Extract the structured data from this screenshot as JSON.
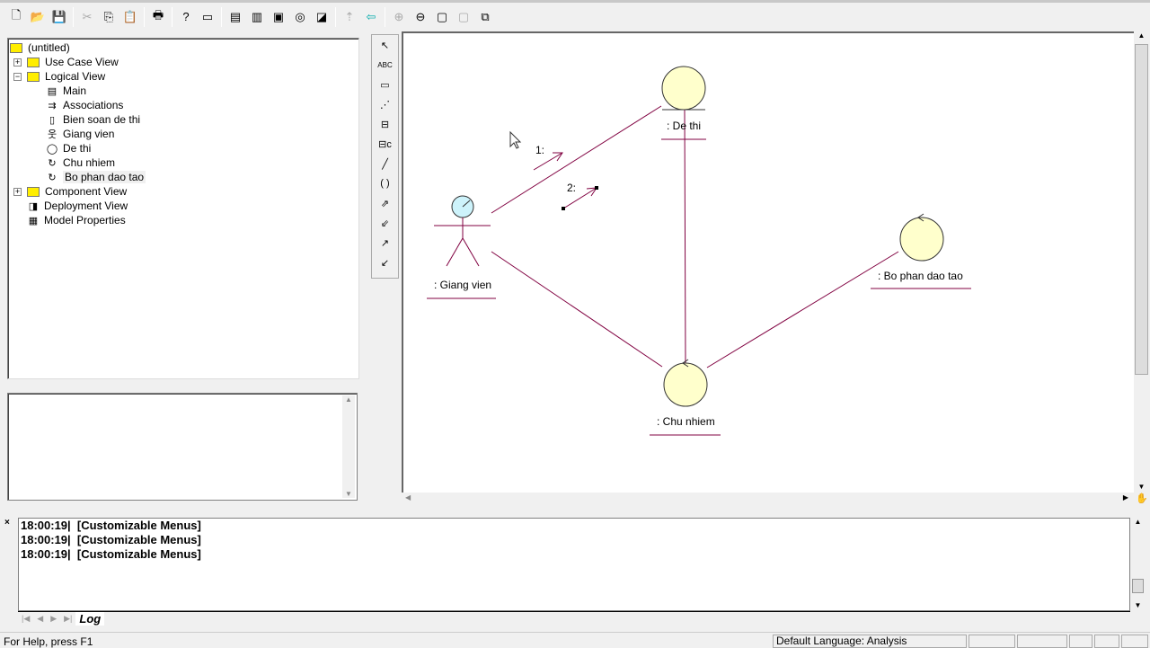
{
  "toolbar": {
    "buttons": [
      "new-icon",
      "open-icon",
      "save-icon",
      "cut-icon",
      "copy-icon",
      "paste-icon",
      "print-icon",
      "context-help-icon",
      "view-doc-icon",
      "class-diagram-icon",
      "interaction-diagram-icon",
      "component-diagram-icon",
      "state-diagram-icon",
      "deployment-diagram-icon",
      "parent-icon",
      "previous-diagram-icon",
      "zoom-in-icon",
      "zoom-out-icon",
      "fit-window-icon",
      "undo-fit-icon",
      "browse-icon"
    ]
  },
  "tree": {
    "root": "(untitled)",
    "items": [
      {
        "label": "Use Case View",
        "kind": "folder",
        "expander": "+"
      },
      {
        "label": "Logical View",
        "kind": "folder",
        "expander": "−"
      },
      {
        "label": "Main",
        "kind": "diagram",
        "child": true
      },
      {
        "label": "Associations",
        "kind": "associations",
        "child": true
      },
      {
        "label": "Bien soan de thi",
        "kind": "collab-diagram",
        "child": true
      },
      {
        "label": "Giang vien",
        "kind": "actor",
        "child": true
      },
      {
        "label": "De thi",
        "kind": "entity",
        "child": true
      },
      {
        "label": "Chu nhiem",
        "kind": "control",
        "child": true
      },
      {
        "label": "Bo phan dao tao",
        "kind": "control",
        "child": true,
        "selected": true
      },
      {
        "label": "Component View",
        "kind": "folder",
        "expander": "+"
      },
      {
        "label": "Deployment View",
        "kind": "deploy"
      },
      {
        "label": "Model Properties",
        "kind": "props"
      }
    ]
  },
  "diagram_tools": [
    "selection-icon",
    "text-icon",
    "note-icon",
    "anchor-note-icon",
    "object-icon",
    "class-instance-icon",
    "object-link-icon",
    "link-to-self-icon",
    "link-message-icon",
    "reverse-link-message-icon",
    "data-flow-icon",
    "reverse-data-flow-icon"
  ],
  "diagram": {
    "objects": {
      "actor": ": Giang vien",
      "dethi": ": De thi",
      "chunhiem": ": Chu nhiem",
      "bophan": ": Bo phan dao tao"
    },
    "messages": [
      "1:",
      "2:"
    ],
    "line_color": "#800040",
    "fill": "#ffffcc"
  },
  "log": {
    "lines": [
      "18:00:19|  [Customizable Menus]",
      "18:00:19|  [Customizable Menus]",
      "18:00:19|  [Customizable Menus]"
    ],
    "tab": "Log"
  },
  "status": {
    "help": "For Help, press F1",
    "language": "Default Language: Analysis"
  }
}
